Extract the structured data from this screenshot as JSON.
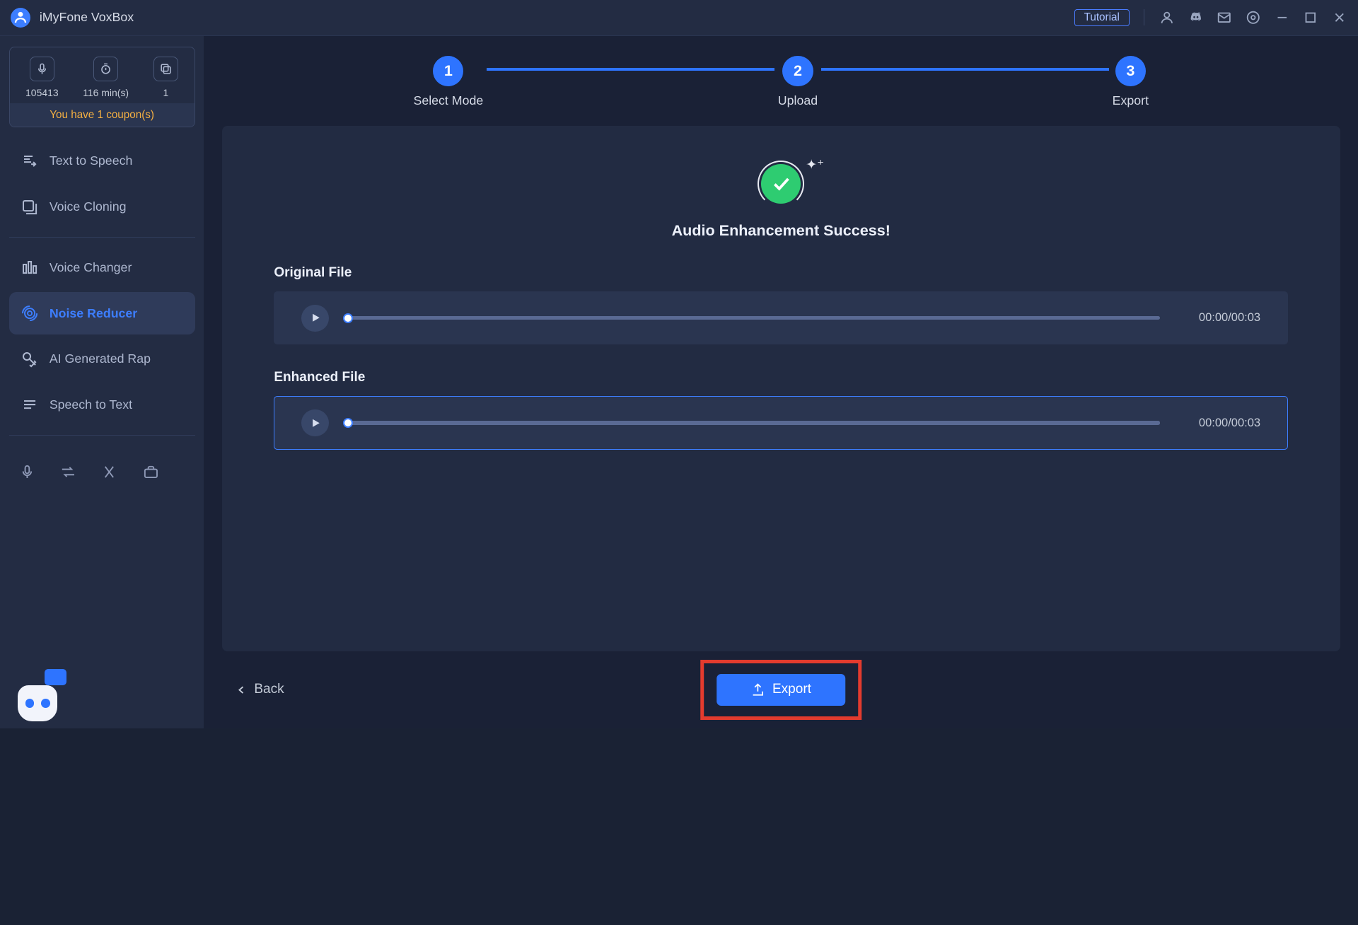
{
  "app": {
    "title": "iMyFone VoxBox"
  },
  "titlebar": {
    "tutorial_label": "Tutorial"
  },
  "credits": {
    "chars": "105413",
    "minutes": "116 min(s)",
    "conversions": "1",
    "coupon_msg": "You have 1 coupon(s)"
  },
  "sidebar": {
    "items": [
      {
        "label": "Text to Speech"
      },
      {
        "label": "Voice Cloning"
      },
      {
        "label": "Voice Changer"
      },
      {
        "label": "Noise Reducer"
      },
      {
        "label": "AI Generated Rap"
      },
      {
        "label": "Speech to Text"
      }
    ]
  },
  "stepper": {
    "step1": {
      "num": "1",
      "label": "Select Mode"
    },
    "step2": {
      "num": "2",
      "label": "Upload"
    },
    "step3": {
      "num": "3",
      "label": "Export"
    }
  },
  "success": {
    "title": "Audio Enhancement Success!"
  },
  "players": {
    "original": {
      "label": "Original File",
      "time": "00:00/00:03"
    },
    "enhanced": {
      "label": "Enhanced File",
      "time": "00:00/00:03"
    }
  },
  "footer": {
    "back_label": "Back",
    "export_label": "Export"
  }
}
